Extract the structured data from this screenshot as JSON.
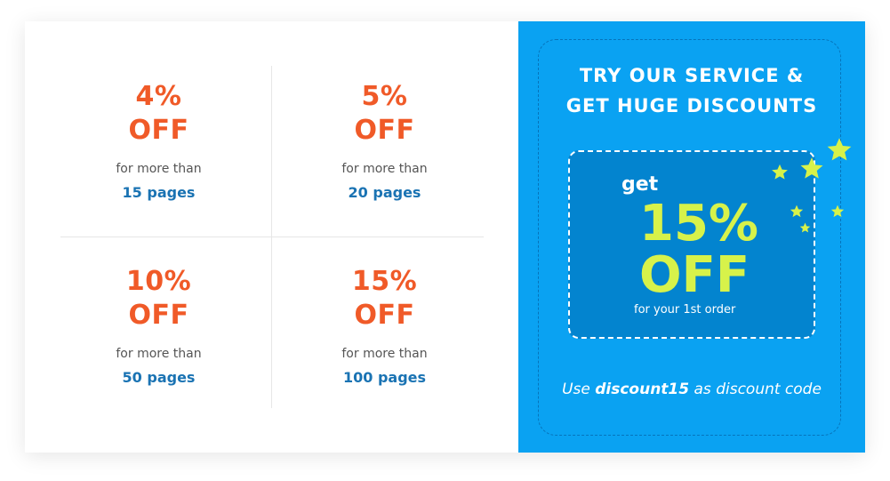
{
  "offers": [
    {
      "pct": "4%",
      "off": "OFF",
      "desc": "for more than",
      "pages": "15 pages"
    },
    {
      "pct": "5%",
      "off": "OFF",
      "desc": "for more than",
      "pages": "20 pages"
    },
    {
      "pct": "10%",
      "off": "OFF",
      "desc": "for more than",
      "pages": "50 pages"
    },
    {
      "pct": "15%",
      "off": "OFF",
      "desc": "for more than",
      "pages": "100 pages"
    }
  ],
  "promo": {
    "title_line1": "TRY OUR SERVICE &",
    "title_line2": "GET HUGE DISCOUNTS",
    "get": "get",
    "discount": "15%",
    "off": "OFF",
    "note": "for your 1st order",
    "code_prefix": "Use",
    "code": "discount15",
    "code_suffix": "as discount code"
  },
  "colors": {
    "accent_orange": "#f05a28",
    "pages_blue": "#1a73b3",
    "panel_blue": "#0aa2f2",
    "coupon_blue": "#0384cf",
    "highlight_lime": "#d7f24a"
  },
  "icons": [
    "star-icon"
  ]
}
